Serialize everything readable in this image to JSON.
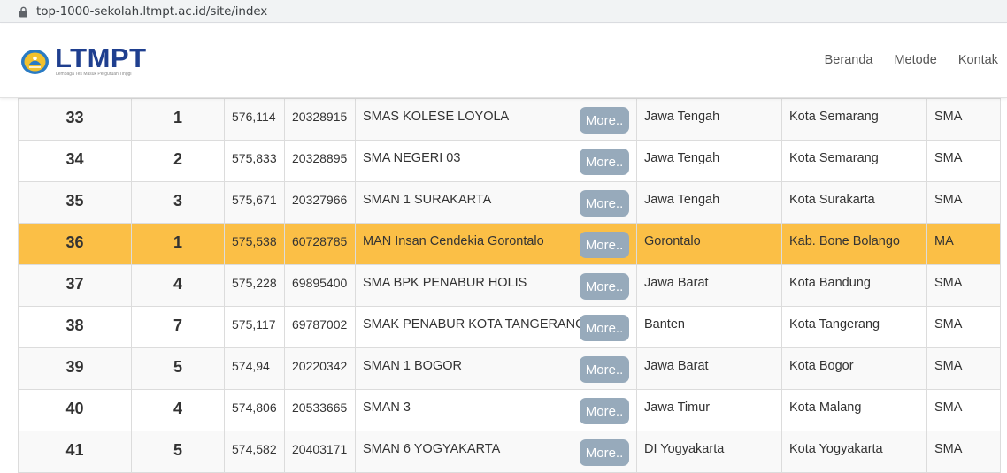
{
  "browser": {
    "url": "top-1000-sekolah.ltmpt.ac.id/site/index"
  },
  "header": {
    "logo_text": "LTMPT",
    "logo_subtitle": "Lembaga Tes Masuk Perguruan Tinggi",
    "nav": [
      "Beranda",
      "Metode",
      "Kontak"
    ]
  },
  "colors": {
    "highlight_row": "#fbbf46",
    "more_button": "#97aabb",
    "logo_blue": "#1f3f8f"
  },
  "table": {
    "more_label": "More..",
    "rows": [
      {
        "rank": "33",
        "prov_rank": "1",
        "score": "576,114",
        "npsn": "20328915",
        "name": "SMAS KOLESE LOYOLA",
        "province": "Jawa Tengah",
        "city": "Kota Semarang",
        "type": "SMA"
      },
      {
        "rank": "34",
        "prov_rank": "2",
        "score": "575,833",
        "npsn": "20328895",
        "name": "SMA NEGERI 03",
        "province": "Jawa Tengah",
        "city": "Kota Semarang",
        "type": "SMA"
      },
      {
        "rank": "35",
        "prov_rank": "3",
        "score": "575,671",
        "npsn": "20327966",
        "name": "SMAN 1 SURAKARTA",
        "province": "Jawa Tengah",
        "city": "Kota Surakarta",
        "type": "SMA"
      },
      {
        "rank": "36",
        "prov_rank": "1",
        "score": "575,538",
        "npsn": "60728785",
        "name": "MAN Insan Cendekia Gorontalo",
        "province": "Gorontalo",
        "city": "Kab. Bone Bolango",
        "type": "MA"
      },
      {
        "rank": "37",
        "prov_rank": "4",
        "score": "575,228",
        "npsn": "69895400",
        "name": "SMA BPK PENABUR HOLIS",
        "province": "Jawa Barat",
        "city": "Kota Bandung",
        "type": "SMA"
      },
      {
        "rank": "38",
        "prov_rank": "7",
        "score": "575,117",
        "npsn": "69787002",
        "name": "SMAK PENABUR KOTA TANGERANG",
        "province": "Banten",
        "city": "Kota Tangerang",
        "type": "SMA"
      },
      {
        "rank": "39",
        "prov_rank": "5",
        "score": "574,94",
        "npsn": "20220342",
        "name": "SMAN 1 BOGOR",
        "province": "Jawa Barat",
        "city": "Kota Bogor",
        "type": "SMA"
      },
      {
        "rank": "40",
        "prov_rank": "4",
        "score": "574,806",
        "npsn": "20533665",
        "name": "SMAN 3",
        "province": "Jawa Timur",
        "city": "Kota Malang",
        "type": "SMA"
      },
      {
        "rank": "41",
        "prov_rank": "5",
        "score": "574,582",
        "npsn": "20403171",
        "name": "SMAN 6 YOGYAKARTA",
        "province": "DI Yogyakarta",
        "city": "Kota Yogyakarta",
        "type": "SMA"
      }
    ]
  }
}
